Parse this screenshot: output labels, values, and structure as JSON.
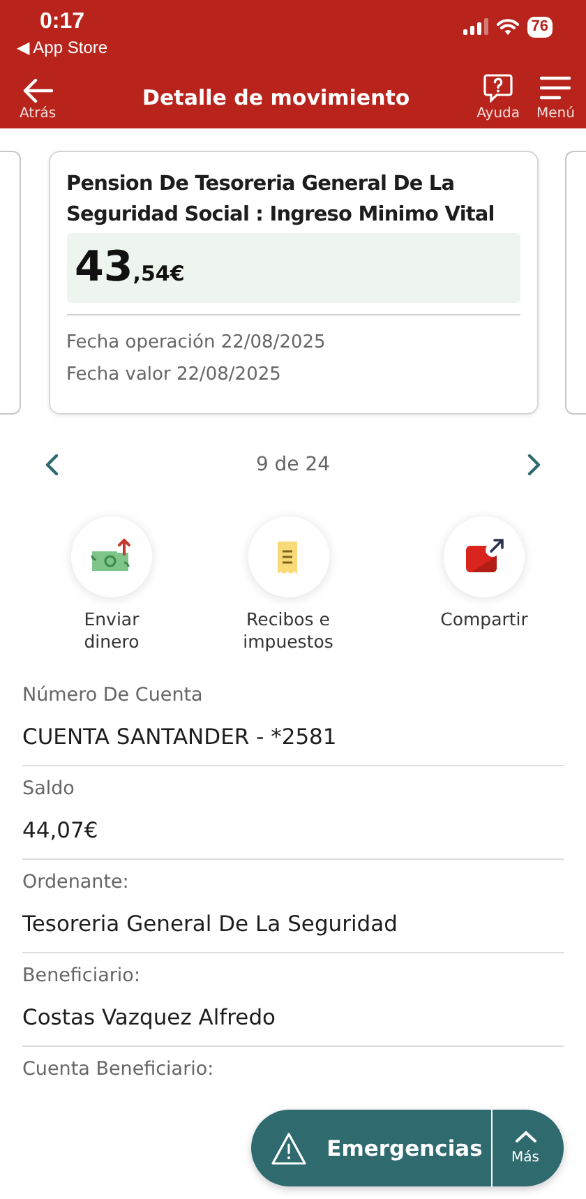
{
  "status_bar": {
    "time": "0:17",
    "back_app": "◀ App Store",
    "battery": "76"
  },
  "nav": {
    "title": "Detalle de movimiento",
    "back": "Atrás",
    "actions": [
      {
        "kind": "help",
        "label": "Ayuda"
      },
      {
        "kind": "menu",
        "label": "Menú"
      }
    ]
  },
  "movement": {
    "description": "Pension De Tesoreria General De La Seguridad Social : Ingreso Minimo Vital",
    "amount": {
      "whole": "43",
      "fraction": ",54€"
    },
    "dates": [
      "Fecha operación 22/08/2025",
      "Fecha valor 22/08/2025"
    ]
  },
  "pager": {
    "position": "9 de 24"
  },
  "quick_actions": [
    {
      "kind": "send",
      "label": "Enviar\ndinero"
    },
    {
      "kind": "receipt",
      "label": "Recibos e\nimpuestos"
    },
    {
      "kind": "share",
      "label": "Compartir"
    }
  ],
  "details": [
    {
      "label": "Número De Cuenta",
      "value": "CUENTA SANTANDER - *2581"
    },
    {
      "label": "Saldo",
      "value": "44,07€"
    },
    {
      "label": "Ordenante:",
      "value": "Tesoreria General De La Seguridad"
    },
    {
      "label": "Beneficiario:",
      "value": "Costas Vazquez Alfredo"
    },
    {
      "label": "Cuenta Beneficiario:"
    }
  ],
  "emergency": {
    "label": "Emergencias",
    "more": "Más"
  }
}
